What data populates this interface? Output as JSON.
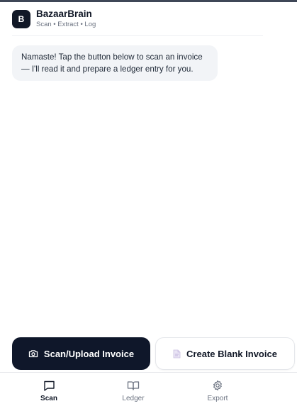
{
  "header": {
    "logo_letter": "B",
    "title": "BazaarBrain",
    "subtitle": "Scan • Extract • Log"
  },
  "chat": {
    "messages": [
      {
        "text": "Namaste! Tap the button below to scan an invoice — I'll read it and prepare a ledger entry for you."
      }
    ]
  },
  "actions": {
    "scan_label": "Scan/Upload Invoice",
    "scan_icon": "camera-icon",
    "blank_label": "Create Blank Invoice",
    "blank_icon": "document-icon"
  },
  "nav": {
    "items": [
      {
        "label": "Scan",
        "icon": "chat-icon",
        "active": true
      },
      {
        "label": "Ledger",
        "icon": "book-icon",
        "active": false
      },
      {
        "label": "Export",
        "icon": "gear-icon",
        "active": false
      }
    ]
  },
  "colors": {
    "primary": "#0f172a",
    "bubble": "#f2f4f7",
    "muted": "#6b7280"
  }
}
